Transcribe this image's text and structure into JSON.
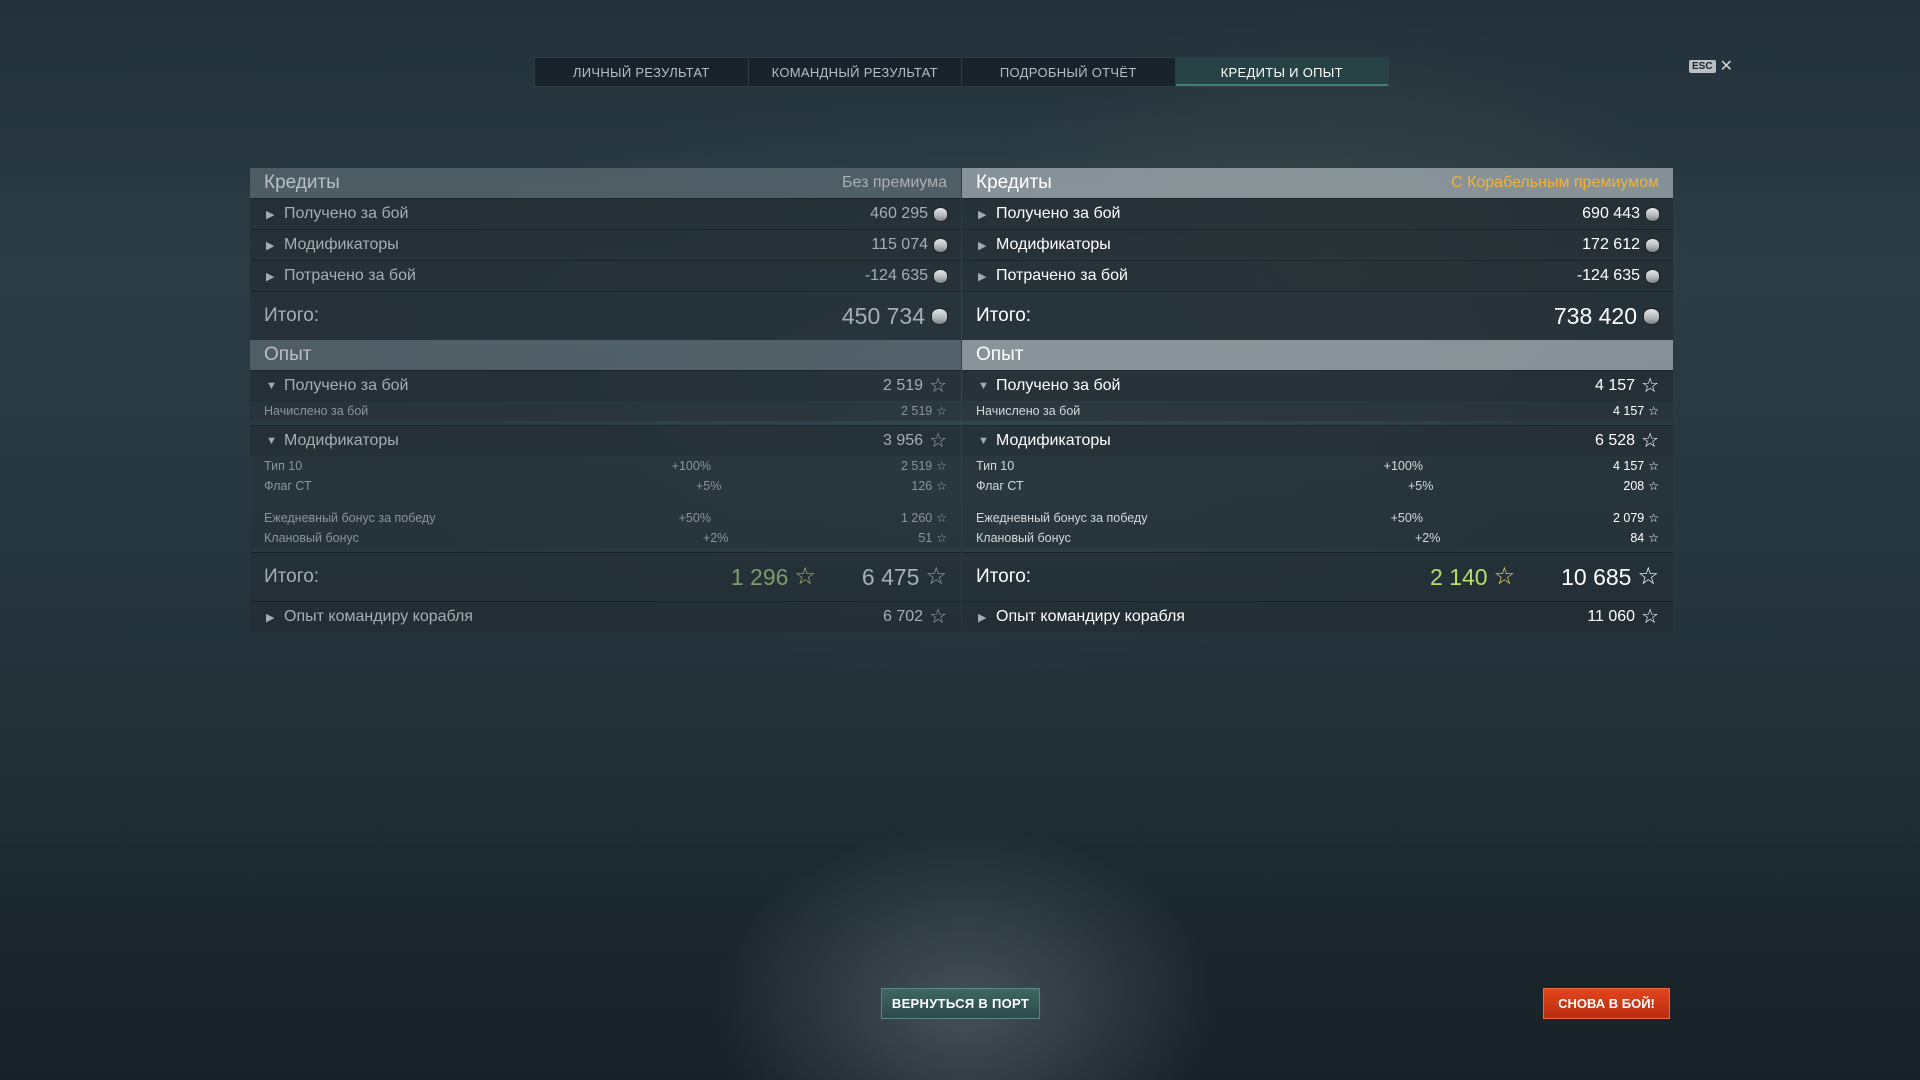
{
  "tabs": [
    "ЛИЧНЫЙ РЕЗУЛЬТАТ",
    "КОМАНДНЫЙ РЕЗУЛЬТАТ",
    "ПОДРОБНЫЙ ОТЧЁТ",
    "КРЕДИТЫ И ОПЫТ"
  ],
  "active_tab": "КРЕДИТЫ И ОПЫТ",
  "close": {
    "key": "ESC",
    "symbol": "✕"
  },
  "left": {
    "credits_title": "Кредиты",
    "credits_subtitle": "Без премиума",
    "credits_rows": [
      {
        "label": "Получено за бой",
        "value": "460 295"
      },
      {
        "label": "Модификаторы",
        "value": "115 074"
      },
      {
        "label": "Потрачено за бой",
        "value": "-124 635"
      }
    ],
    "credits_total_label": "Итого:",
    "credits_total": "450 734",
    "xp_title": "Опыт",
    "xp_earned_label": "Получено за бой",
    "xp_earned": "2 519",
    "xp_accrued_label": "Начислено за бой",
    "xp_accrued": "2 519",
    "mods_label": "Модификаторы",
    "mods_value": "3 956",
    "mods": [
      {
        "label": "Тип 10",
        "pct": "+100%",
        "value": "2 519"
      },
      {
        "label": "Флаг СТ",
        "pct": "+5%",
        "value": "126"
      },
      {
        "label": "Ежедневный бонус за победу",
        "pct": "+50%",
        "value": "1 260"
      },
      {
        "label": "Клановый бонус",
        "pct": "+2%",
        "value": "51"
      }
    ],
    "xp_total_label": "Итого:",
    "xp_total_free": "1 296",
    "xp_total": "6 475",
    "commander_label": "Опыт командиру корабля",
    "commander_value": "6 702"
  },
  "right": {
    "credits_title": "Кредиты",
    "credits_subtitle": "С Корабельным премиумом",
    "credits_rows": [
      {
        "label": "Получено за бой",
        "value": "690 443"
      },
      {
        "label": "Модификаторы",
        "value": "172 612"
      },
      {
        "label": "Потрачено за бой",
        "value": "-124 635"
      }
    ],
    "credits_total_label": "Итого:",
    "credits_total": "738 420",
    "xp_title": "Опыт",
    "xp_earned_label": "Получено за бой",
    "xp_earned": "4 157",
    "xp_accrued_label": "Начислено за бой",
    "xp_accrued": "4 157",
    "mods_label": "Модификаторы",
    "mods_value": "6 528",
    "mods": [
      {
        "label": "Тип 10",
        "pct": "+100%",
        "value": "4 157"
      },
      {
        "label": "Флаг СТ",
        "pct": "+5%",
        "value": "208"
      },
      {
        "label": "Ежедневный бонус за победу",
        "pct": "+50%",
        "value": "2 079"
      },
      {
        "label": "Клановый бонус",
        "pct": "+2%",
        "value": "84"
      }
    ],
    "xp_total_label": "Итого:",
    "xp_total_free": "2 140",
    "xp_total": "10 685",
    "commander_label": "Опыт командиру корабля",
    "commander_value": "11 060"
  },
  "buttons": {
    "port": "ВЕРНУТЬСЯ В ПОРТ",
    "battle": "СНОВА В БОЙ!"
  },
  "icons": {
    "credits": "credits-coin-icon",
    "xp": "xp-star-icon",
    "expand": "chevron-right-icon",
    "collapse": "chevron-down-icon"
  },
  "colors": {
    "premium_accent": "#f0b23a",
    "free_xp_premium": "#b7df6a",
    "battle_button": "#d33a16",
    "port_button": "#34585a"
  }
}
